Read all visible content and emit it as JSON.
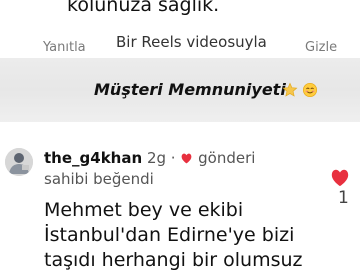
{
  "top": {
    "caption_line": "kolunuza sağlık.",
    "reply_label": "Yanıtla",
    "reels_caption": "Bir Reels videosuyla",
    "hide_label": "Gizle"
  },
  "banner": {
    "title": "Müşteri Memnuniyeti",
    "emojis": [
      "star-icon",
      "smile-icon"
    ],
    "colors": {
      "banner_bg": "#ececec",
      "title": "#111111"
    }
  },
  "comment": {
    "username": "the_g4khan",
    "age": "2g",
    "separator": "·",
    "liked_text": "gönderi sahibi beğendi",
    "liked_text_line1": "gönderi",
    "liked_text_line2": "sahibi beğendi",
    "body_lines": [
      "Mehmet bey ve ekibi",
      "İstanbul'dan Edirne'ye bizi",
      "taşıdı herhangi bir olumsuz"
    ],
    "like_count": "1",
    "colors": {
      "like_red": "#e8303f",
      "meta": "#555555"
    }
  }
}
